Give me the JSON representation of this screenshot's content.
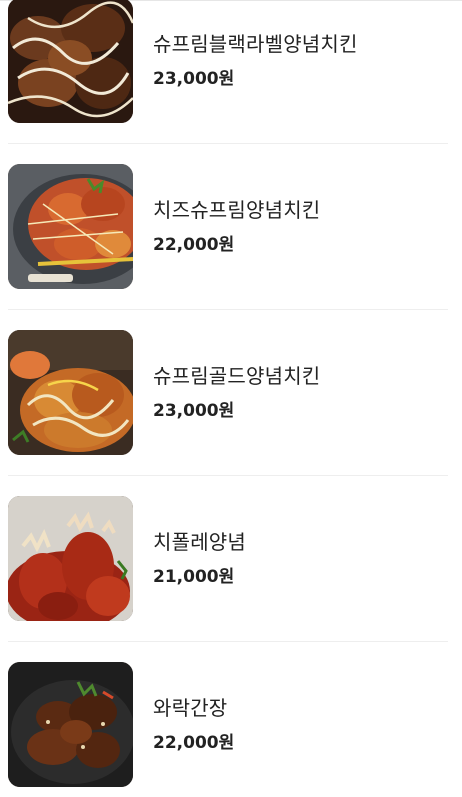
{
  "menu": {
    "items": [
      {
        "name": "슈프림블랙라벨양념치킨",
        "price": "23,000원",
        "image": "chicken-black-label-photo"
      },
      {
        "name": "치즈슈프림양념치킨",
        "price": "22,000원",
        "image": "chicken-cheese-supreme-photo"
      },
      {
        "name": "슈프림골드양념치킨",
        "price": "23,000원",
        "image": "chicken-gold-supreme-photo"
      },
      {
        "name": "치폴레양념",
        "price": "21,000원",
        "image": "chicken-chipotle-photo"
      },
      {
        "name": "와락간장",
        "price": "22,000원",
        "image": "chicken-soy-photo"
      }
    ]
  }
}
